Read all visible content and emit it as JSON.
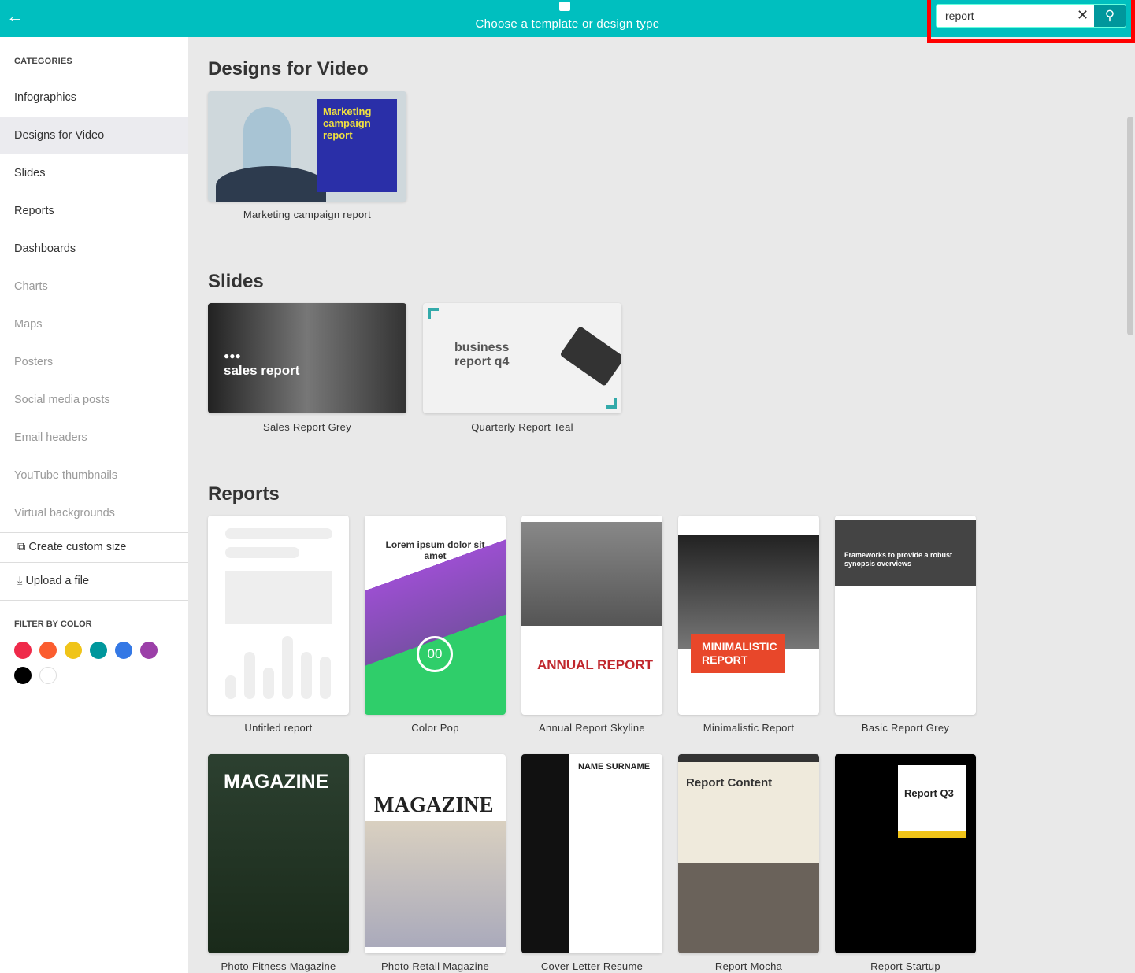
{
  "header": {
    "title": "Choose a template or design type",
    "back_icon": "arrow-left-icon",
    "search_value": "report",
    "search_placeholder": "Search"
  },
  "sidebar": {
    "categories_heading": "CATEGORIES",
    "items": [
      {
        "label": "Infographics",
        "state": "enabled"
      },
      {
        "label": "Designs for Video",
        "state": "active"
      },
      {
        "label": "Slides",
        "state": "enabled"
      },
      {
        "label": "Reports",
        "state": "enabled"
      },
      {
        "label": "Dashboards",
        "state": "enabled"
      },
      {
        "label": "Charts",
        "state": "disabled"
      },
      {
        "label": "Maps",
        "state": "disabled"
      },
      {
        "label": "Posters",
        "state": "disabled"
      },
      {
        "label": "Social media posts",
        "state": "disabled"
      },
      {
        "label": "Email headers",
        "state": "disabled"
      },
      {
        "label": "YouTube thumbnails",
        "state": "disabled"
      },
      {
        "label": "Virtual backgrounds",
        "state": "disabled"
      }
    ],
    "create_custom_size": "Create custom size",
    "upload_file": "Upload a file",
    "filter_heading": "FILTER BY COLOR",
    "colors": [
      "#ef2a4a",
      "#fb5d2f",
      "#f0c419",
      "#00979c",
      "#3478e5",
      "#9b3fa8",
      "#000000",
      "#ffffff"
    ]
  },
  "sections": {
    "video": {
      "title": "Designs for Video",
      "templates": [
        {
          "name": "Marketing campaign report",
          "thumb_text": "Marketing campaign report"
        }
      ]
    },
    "slides": {
      "title": "Slides",
      "templates": [
        {
          "name": "Sales Report Grey",
          "thumb_text": "sales report"
        },
        {
          "name": "Quarterly Report Teal",
          "thumb_text": "business report q4"
        }
      ]
    },
    "reports": {
      "title": "Reports",
      "templates": [
        {
          "name": "Untitled report",
          "thumb_text": ""
        },
        {
          "name": "Color Pop",
          "thumb_text": "Lorem ipsum dolor sit amet"
        },
        {
          "name": "Annual Report Skyline",
          "thumb_text": "ANNUAL REPORT"
        },
        {
          "name": "Minimalistic Report",
          "thumb_text": "MINIMALISTIC REPORT"
        },
        {
          "name": "Basic Report Grey",
          "thumb_text": "Frameworks to provide a robust synopsis overviews"
        },
        {
          "name": "Photo Fitness Magazine",
          "thumb_text": "MAGAZINE"
        },
        {
          "name": "Photo Retail Magazine",
          "thumb_text": "MAGAZINE"
        },
        {
          "name": "Cover Letter Resume",
          "thumb_text": "NAME SURNAME"
        },
        {
          "name": "Report Mocha",
          "thumb_text": "Report Content"
        },
        {
          "name": "Report Startup",
          "thumb_text": "Report Q3"
        }
      ]
    }
  }
}
